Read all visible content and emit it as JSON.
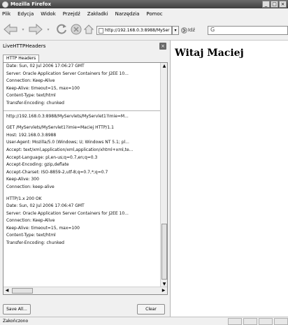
{
  "window": {
    "title": "Mozilla Firefox"
  },
  "menu": [
    "Plik",
    "Edycja",
    "Widok",
    "Przejdź",
    "Zakładki",
    "Narzędzia",
    "Pomoc"
  ],
  "toolbar": {
    "url": "http://192.168.0.3:8988/MySer",
    "go_label": "Idź",
    "search_icon": "G"
  },
  "sidebar": {
    "title": "LiveHTTPHeaders",
    "tab": "HTTP Headers",
    "block1": [
      "Date: Sun, 02 Jul 2006 17:06:27 GMT",
      "Server: Oracle Application Server Containers for J2EE 10...",
      "Connection: Keep-Alive",
      "Keep-Alive: timeout=15, max=100",
      "Content-Type: text/html",
      "Transfer-Encoding: chunked"
    ],
    "url_line": "http://192.168.0.3:8988/MyServlets/MyServlet1?imie=M...",
    "request": [
      "GET /MyServlets/MyServlet1?imie=Maciej HTTP/1.1",
      "Host: 192.168.0.3:8988",
      "User-Agent: Mozilla/5.0 (Windows; U; Windows NT 5.1; pl...",
      "Accept: text/xml,application/xml,application/xhtml+xml,te...",
      "Accept-Language: pl,en-us;q=0.7,en;q=0.3",
      "Accept-Encoding: gzip,deflate",
      "Accept-Charset: ISO-8859-2,utf-8;q=0.7,*;q=0.7",
      "Keep-Alive: 300",
      "Connection: keep-alive"
    ],
    "response": [
      "HTTP/1.x 200 OK",
      "Date: Sun, 02 Jul 2006 17:06:47 GMT",
      "Server: Oracle Application Server Containers for J2EE 10...",
      "Connection: Keep-Alive",
      "Keep-Alive: timeout=15, max=100",
      "Content-Type: text/html",
      "Transfer-Encoding: chunked"
    ],
    "save_label": "Save All...",
    "clear_label": "Clear"
  },
  "content": {
    "heading": "Witaj Maciej"
  },
  "status": {
    "text": "Zakończono"
  }
}
